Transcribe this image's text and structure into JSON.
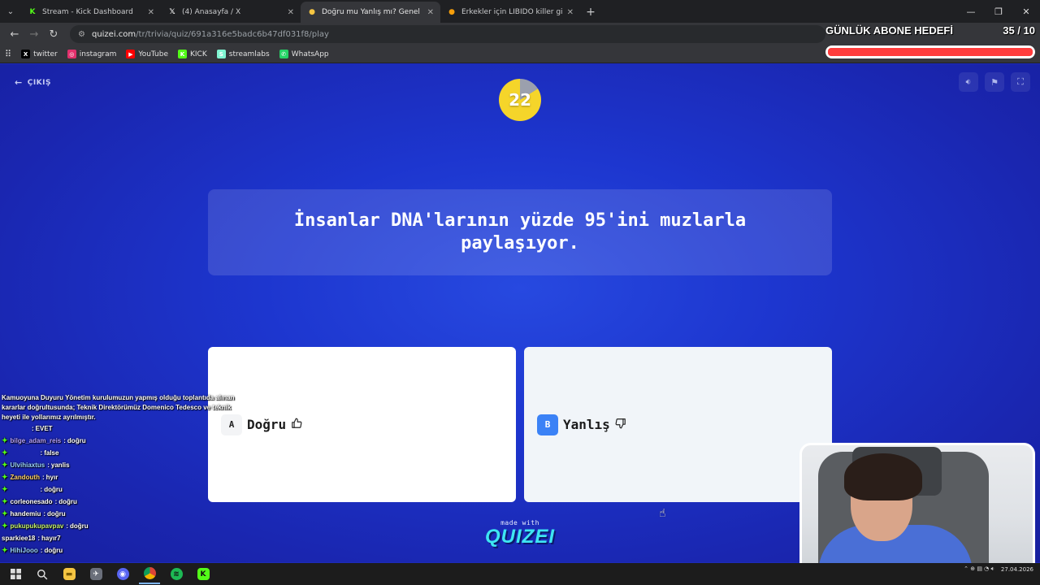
{
  "browser": {
    "tabs": [
      {
        "title": "Stream - Kick Dashboard",
        "icon": "kick-icon",
        "color": "#53fc18",
        "glyph": "K"
      },
      {
        "title": "(4) Anasayfa / X",
        "icon": "x-icon",
        "color": "#ffffff",
        "glyph": "𝕏"
      },
      {
        "title": "Doğru mu Yanlış mı? Genel Kül",
        "icon": "quizei-icon",
        "color": "#f5c542",
        "glyph": "●",
        "active": true
      },
      {
        "title": "Erkekler için LİBİDO killer giysi",
        "icon": "site-icon",
        "color": "#f59e0b",
        "glyph": "●"
      }
    ],
    "url_host": "quizei.com",
    "url_path": "/tr/trivia/quiz/691a316e5badc6b47df031f8/play",
    "bookmarks": [
      {
        "label": "twitter",
        "icon": "x-icon",
        "color": "#000000",
        "glyph": "X"
      },
      {
        "label": "instagram",
        "icon": "instagram-icon",
        "color": "#e1306c",
        "glyph": "◎"
      },
      {
        "label": "YouTube",
        "icon": "youtube-icon",
        "color": "#ff0000",
        "glyph": "▶"
      },
      {
        "label": "KICK",
        "icon": "kick-icon",
        "color": "#53fc18",
        "glyph": "K"
      },
      {
        "label": "streamlabs",
        "icon": "streamlabs-icon",
        "color": "#80f5d2",
        "glyph": "S"
      },
      {
        "label": "WhatsApp",
        "icon": "whatsapp-icon",
        "color": "#25d366",
        "glyph": "✆"
      }
    ]
  },
  "goal": {
    "title": "GÜNLÜK ABONE HEDEFİ",
    "count": "35 / 10",
    "progress": 1.0
  },
  "quiz": {
    "exit_label": "ÇIKIŞ",
    "timer": "22",
    "question": "İnsanlar DNA'larının yüzde 95'ini muzlarla paylaşıyor.",
    "answers": [
      {
        "key": "A",
        "label": "Doğru",
        "icon": "thumbs-up-icon"
      },
      {
        "key": "B",
        "label": "Yanlış",
        "icon": "thumbs-down-icon"
      }
    ],
    "made_with": "made with",
    "brand": "QUIZEI"
  },
  "chat": [
    {
      "user": "",
      "text": "Kamuoyuna Duyuru Yönetim kurulumuzun yapmış olduğu toplantıda alınan kararlar doğrultusunda; Teknik Direktörümüz Domenico Tedesco ve teknik heyeti ile yollarımız ayrılmıştır.",
      "color": "#ffffff",
      "badge": false
    },
    {
      "user": "",
      "text": "EVET",
      "color": "#ff4d4d",
      "badge": false
    },
    {
      "user": "bilge_adam_reis",
      "text": "doğru",
      "color": "#b8a3ff",
      "badge": true
    },
    {
      "user": "",
      "text": "false",
      "color": "#ff4d4d",
      "badge": true
    },
    {
      "user": "Ulvihiaxtus",
      "text": "yanlis",
      "color": "#9bd4ff",
      "badge": true
    },
    {
      "user": "Zandouth",
      "text": "hyır",
      "color": "#ffd166",
      "badge": true
    },
    {
      "user": "",
      "text": "doğru",
      "color": "#ff4d4d",
      "badge": true
    },
    {
      "user": "corleonesado",
      "text": "doğru",
      "color": "#ffffff",
      "badge": true
    },
    {
      "user": "handemiu",
      "text": "doğru",
      "color": "#ffffff",
      "badge": true
    },
    {
      "user": "pukupukupavpav",
      "text": "doğru",
      "color": "#c4f06b",
      "badge": true
    },
    {
      "user": "sparkiee18",
      "text": "hayır7",
      "color": "#ffffff",
      "badge": false
    },
    {
      "user": "HihiJooo",
      "text": "doğru",
      "color": "#9bd4ff",
      "badge": true
    }
  ],
  "tray": {
    "date": "27.04.2026"
  }
}
